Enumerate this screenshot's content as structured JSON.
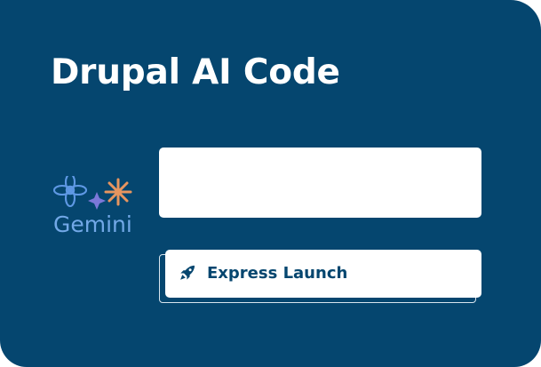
{
  "card": {
    "title": "Drupal AI Code"
  },
  "logo": {
    "text": "Gemini",
    "icons": [
      "flower-icon",
      "sparkle-icon",
      "asterisk-icon"
    ]
  },
  "prompt": {
    "value": ""
  },
  "actions": {
    "express_label": "Express Launch",
    "express_icon": "rocket-icon"
  },
  "colors": {
    "background": "#05466f",
    "panel": "#ffffff",
    "logo_blue": "#5e98e4",
    "logo_violet": "#7c78d9",
    "logo_orange": "#e7955f"
  }
}
